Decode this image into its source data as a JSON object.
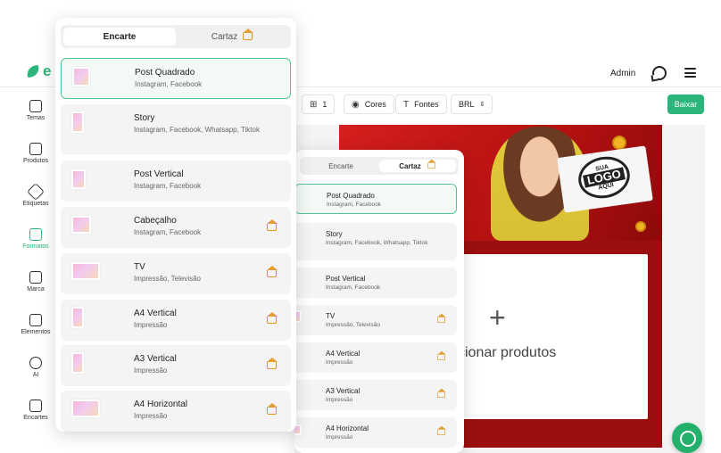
{
  "app": {
    "brand_letter": "e",
    "user": "Admin"
  },
  "sidebar": {
    "items": [
      {
        "label": "Temas",
        "icon": "image-icon"
      },
      {
        "label": "Produtos",
        "icon": "cart-icon"
      },
      {
        "label": "Etiquetas",
        "icon": "tag-icon"
      },
      {
        "label": "Formatos",
        "icon": "layout-icon",
        "active": true
      },
      {
        "label": "Marca",
        "icon": "building-icon"
      },
      {
        "label": "Elementos",
        "icon": "shapes-icon"
      },
      {
        "label": "AI",
        "icon": "ai-icon"
      },
      {
        "label": "Encartes",
        "icon": "grid-icon"
      }
    ]
  },
  "toolbar": {
    "pages_value": "1",
    "colors_label": "Cores",
    "fonts_label": "Fontes",
    "currency_value": "BRL",
    "download_label": "Baixar"
  },
  "canvas": {
    "add_products_text": "cionar produtos",
    "logo_top": "SUA",
    "logo_main": "LOGO",
    "logo_bottom": "AQUI"
  },
  "format_panel": {
    "tabs": [
      {
        "label": "Encarte",
        "active": true
      },
      {
        "label": "Cartaz",
        "premium": true
      }
    ],
    "items": [
      {
        "title": "Post Quadrado",
        "subtitle": "Instagram, Facebook",
        "selected": true,
        "premium": false
      },
      {
        "title": "Story",
        "subtitle": "Instagram, Facebook, Whatsapp, Tiktok",
        "premium": false
      },
      {
        "title": "Post Vertical",
        "subtitle": "Instagram, Facebook",
        "premium": false
      },
      {
        "title": "Cabeçalho",
        "subtitle": "Instagram, Facebook",
        "premium": true
      },
      {
        "title": "TV",
        "subtitle": "Impressão, Televisão",
        "premium": true
      },
      {
        "title": "A4 Vertical",
        "subtitle": "Impressão",
        "premium": true
      },
      {
        "title": "A3 Vertical",
        "subtitle": "Impressão",
        "premium": true
      },
      {
        "title": "A4 Horizontal",
        "subtitle": "Impressão",
        "premium": true
      }
    ]
  },
  "format_panel_secondary": {
    "tabs": [
      {
        "label": "Encarte",
        "active": false
      },
      {
        "label": "Cartaz",
        "active": true,
        "premium": true
      }
    ],
    "items": [
      {
        "title": "Post Quadrado",
        "subtitle": "Instagram, Facebook",
        "selected": true
      },
      {
        "title": "Story",
        "subtitle": "Instagram, Facebook, Whatsapp, Tiktok"
      },
      {
        "title": "Post Vertical",
        "subtitle": "Instagram, Facebook"
      },
      {
        "title": "TV",
        "subtitle": "Impressão, Televisão",
        "premium": true
      },
      {
        "title": "A4 Vertical",
        "subtitle": "Impressão",
        "premium": true
      },
      {
        "title": "A3 Vertical",
        "subtitle": "Impressão",
        "premium": true
      },
      {
        "title": "A4 Horizontal",
        "subtitle": "Impressão",
        "premium": true
      }
    ]
  },
  "colors": {
    "accent": "#2cb57a",
    "premium": "#e0951c",
    "poster_red": "#b31010"
  }
}
